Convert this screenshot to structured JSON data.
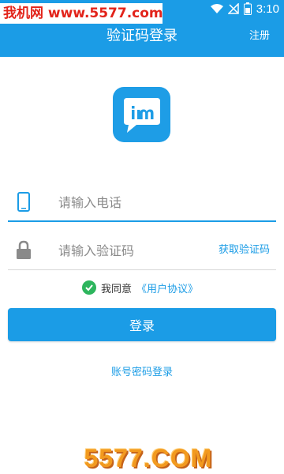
{
  "status_bar": {
    "time": "3:10",
    "battery_icon": "battery-icon",
    "wifi_icon": "wifi-icon",
    "signal_icon": "signal-off-icon"
  },
  "watermark": {
    "top_text": "我机网 www.5577.com",
    "bottom_text": "5577.COM"
  },
  "header": {
    "title": "验证码登录",
    "action": "注册"
  },
  "logo": {
    "text": "im",
    "icon": "im-chat-bubble-logo"
  },
  "form": {
    "phone_placeholder": "请输入电话",
    "code_placeholder": "请输入验证码",
    "get_code_label": "获取验证码",
    "phone_icon": "phone-icon",
    "lock_icon": "lock-icon"
  },
  "agreement": {
    "prefix": "我同意",
    "link": "《用户协议》",
    "checked": true
  },
  "login_button": {
    "label": "登录"
  },
  "alt_login": {
    "label": "账号密码登录"
  },
  "colors": {
    "primary": "#1b9ce6",
    "check": "#2db55d",
    "watermark_red": "#e2231a",
    "watermark_orange": "#f29a1f"
  }
}
